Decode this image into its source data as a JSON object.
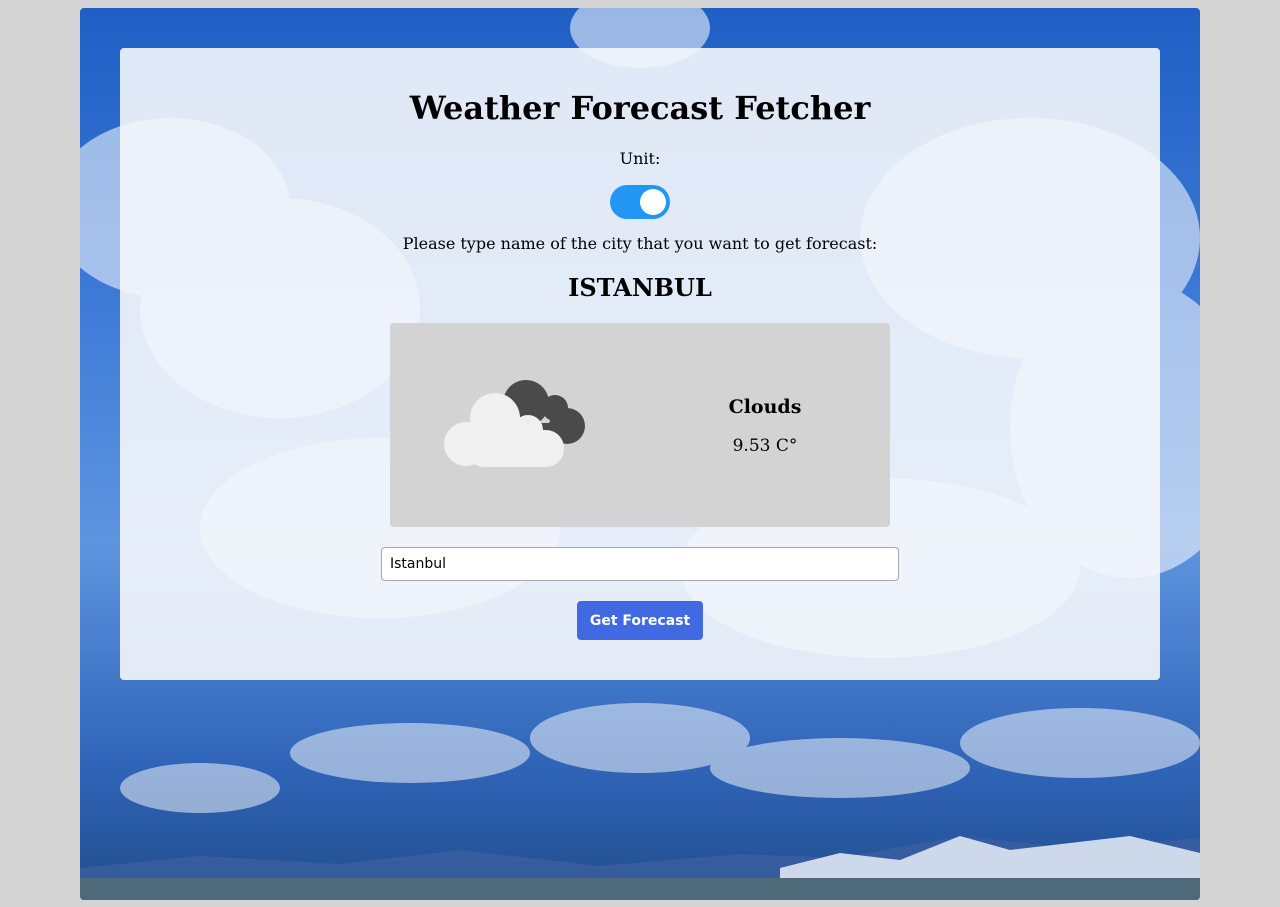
{
  "app": {
    "title": "Weather Forecast Fetcher"
  },
  "unit": {
    "label": "Unit:",
    "toggle_on": true
  },
  "prompt": "Please type name of the city that you want to get forecast:",
  "forecast": {
    "city": "ISTANBUL",
    "icon": "clouds-icon",
    "condition": "Clouds",
    "temperature": "9.53 C°"
  },
  "search": {
    "value": "Istanbul"
  },
  "actions": {
    "get_forecast_label": "Get Forecast"
  },
  "colors": {
    "toggle": "#2196f3",
    "button": "#4169e1",
    "card": "#d3d3d3"
  }
}
